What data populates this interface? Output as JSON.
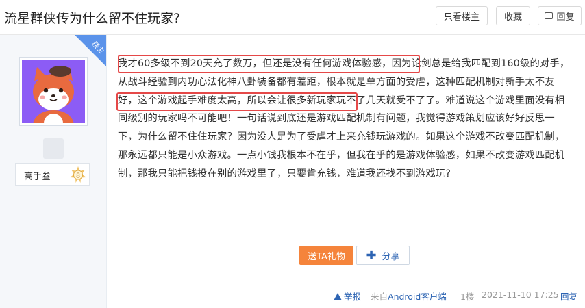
{
  "header": {
    "title": "流星群侠传为什么留不住玩家?",
    "only_author_label": "只看楼主",
    "favorite_label": "收藏",
    "reply_label": "回复"
  },
  "post": {
    "owner_tag": "楼主",
    "user": {
      "level_title": "高手叁",
      "level_number": "8"
    },
    "paragraph": "我才60多级不到20天充了数万，但还是没有任何游戏体验感，因为论剑总是给我匹配到160级的对手，从战斗经验到内功心法化神八卦装备都有差距，根本就是单方面的受虐，这种匹配机制对新手太不友好，这个游戏起手难度太高，所以会让很多新玩家玩不了几天就受不了了。难道说这个游戏里面没有相同级别的玩家吗不可能吧！一句话说到底还是游戏匹配机制有问题，我觉得游戏策划应该好好反思一下，为什么留不住住玩家？因为没人是为了受虐才上来充钱玩游戏的。如果这个游戏不改变匹配机制，那永远都只能是小众游戏。一点小钱我根本不在乎，但我在乎的是游戏体验感，如果不改变游戏匹配机制，那我只能把钱投在别的游戏里了，只要肯充钱，难道我还找不到游戏玩?",
    "gift_label": "送TA礼物",
    "share_label": "分享",
    "footer": {
      "report_label": "举报",
      "from_prefix": "来自",
      "from_app": "Android客户端",
      "floor": "1楼",
      "time": "2021-11-10 17:25",
      "reply_label": "回复"
    }
  },
  "colors": {
    "accent_blue": "#2d64b3",
    "gift_orange": "#f5843b",
    "highlight_red": "#e54848"
  }
}
